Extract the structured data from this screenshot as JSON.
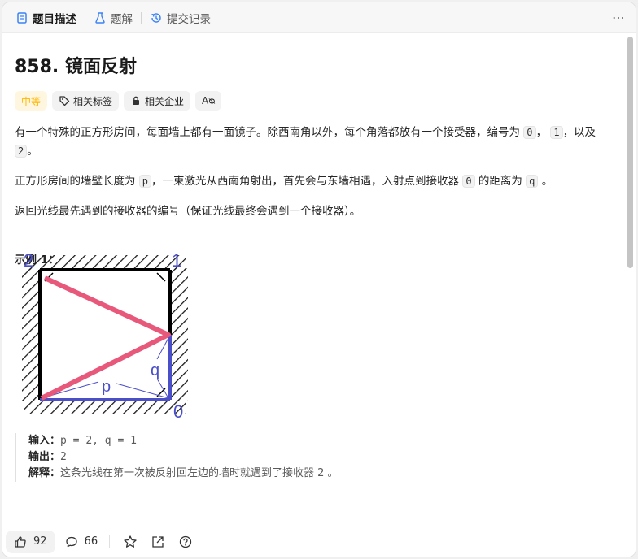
{
  "tabs": [
    {
      "label": "题目描述",
      "icon": "description-icon"
    },
    {
      "label": "题解",
      "icon": "flask-icon"
    },
    {
      "label": "提交记录",
      "icon": "history-icon"
    }
  ],
  "problem": {
    "title": "858. 镜面反射",
    "tags": {
      "difficulty": "中等",
      "related_tags": "相关标签",
      "related_companies": "相关企业",
      "translate": "Aᴓ"
    },
    "desc1": {
      "a": "有一个特殊的正方形房间，每面墙上都有一面镜子。除西南角以外，每个角落都放有一个接受器，编号为",
      "c0": "0",
      "b": "，",
      "c1": "1",
      "c": "，以及",
      "c2": "2",
      "d": "。"
    },
    "desc2": {
      "a": "正方形房间的墙壁长度为",
      "cp": "p",
      "b": "，一束激光从西南角射出，首先会与东墙相遇，入射点到接收器",
      "c0": "0",
      "c": "的距离为",
      "cq": "q",
      "d": "。"
    },
    "desc3": "返回光线最先遇到的接收器的编号（保证光线最终会遇到一个接收器）。",
    "example_title": "示例 1：",
    "figure_labels": {
      "corner2": "2",
      "corner1": "1",
      "corner0": "0",
      "p": "p",
      "q": "q"
    },
    "example": {
      "input_label": "输入：",
      "input_value": "p = 2, q = 1",
      "output_label": "输出：",
      "output_value": "2",
      "explain_label": "解释：",
      "explain_value": "这条光线在第一次被反射回左边的墙时就遇到了接收器 2 。"
    }
  },
  "bottom": {
    "likes": "92",
    "comments": "66"
  },
  "colors": {
    "accent": "#ffb800",
    "beam": "#e8587a",
    "wall_blue": "#4b4fc7"
  }
}
